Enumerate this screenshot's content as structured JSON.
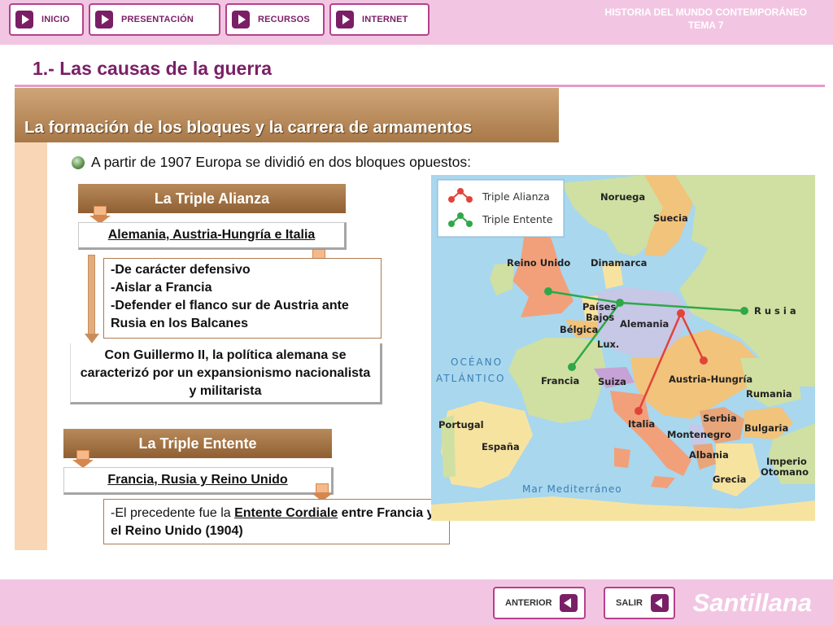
{
  "nav": {
    "items": [
      {
        "label": "INICIO"
      },
      {
        "label": "PRESENTACIÓN"
      },
      {
        "label": "RECURSOS"
      },
      {
        "label": "INTERNET"
      }
    ]
  },
  "header": {
    "subject": "HISTORIA DEL MUNDO CONTEMPORÁNEO",
    "unit": "TEMA 7"
  },
  "page": {
    "title": "1.- Las causas de la guerra",
    "banner": "La formación de los bloques y la carrera de armamentos",
    "intro": "A partir de 1907 Europa se dividió en dos bloques opuestos:"
  },
  "alianza": {
    "heading": "La Triple Alianza",
    "members": "Alemania, Austria-Hungría e Italia",
    "points": [
      "-De carácter defensivo",
      "-Aislar a Francia",
      "-Defender el flanco sur de Austria ante Rusia en los Balcanes"
    ],
    "paragraph": "Con Guillermo II, la política alemana se caracterizó por un expansionismo nacionalista y militarista"
  },
  "entente": {
    "heading": "La Triple Entente",
    "members": "Francia, Rusia y Reino Unido",
    "note_prefix": "-El precedente fue la ",
    "note_link": "Entente Cordiale",
    "note_suffix": " entre Francia y el Reino Unido (1904)"
  },
  "map": {
    "legend": [
      {
        "label": "Triple Alianza",
        "color": "#e0443a"
      },
      {
        "label": "Triple Entente",
        "color": "#2fa84a"
      }
    ],
    "countries": [
      "Noruega",
      "Suecia",
      "Reino Unido",
      "Dinamarca",
      "Países",
      "Bajos",
      "Bélgica",
      "Alemania",
      "Lux.",
      "Francia",
      "Suiza",
      "Austria-Hungría",
      "Rumania",
      "Portugal",
      "España",
      "Italia",
      "Serbia",
      "Bulgaria",
      "Montenegro",
      "Albania",
      "Imperio",
      "Otomano",
      "Grecia",
      "R u s i a"
    ],
    "seas": [
      "OCÉANO",
      "ATLÁNTICO",
      "Mar Mediterráneo"
    ]
  },
  "footer": {
    "prev": "ANTERIOR",
    "exit": "SALIR",
    "brand": "Santillana"
  }
}
